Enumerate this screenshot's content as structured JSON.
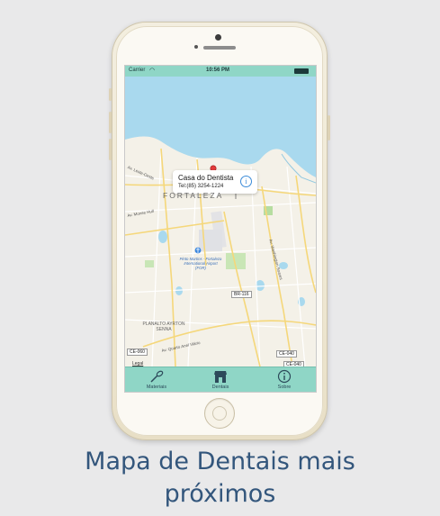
{
  "status_bar": {
    "carrier": "Carrier",
    "time": "10:56 PM"
  },
  "map": {
    "city_label": "FORTALEZA",
    "street_labels": [
      "Av. Leste-Oeste",
      "Av. Monse Hull",
      "Av. Washington Soares",
      "Av. Quarto Anel Viário",
      "PLANALTO AYRTON SENNA"
    ],
    "airport_label": "Pinto Martins - Fortaleza International Airport (FOR)",
    "road_badges": [
      "BR-116",
      "CE-060",
      "CE-040",
      "CE-040"
    ],
    "legal": "Legal",
    "callout": {
      "title": "Casa do Dentista",
      "phone": "Tel:(85) 3254-1224"
    }
  },
  "tabs": [
    {
      "label": "Materiais",
      "icon": "dental-tool-icon"
    },
    {
      "label": "Dentais",
      "icon": "store-icon"
    },
    {
      "label": "Sobre",
      "icon": "info-icon"
    }
  ],
  "caption": {
    "line1": "Mapa de Dentais mais",
    "line2": "próximos"
  },
  "colors": {
    "tint": "#8fd6c6",
    "caption": "#33567c",
    "water": "#a7d8ed",
    "pin": "#e33b3b"
  }
}
